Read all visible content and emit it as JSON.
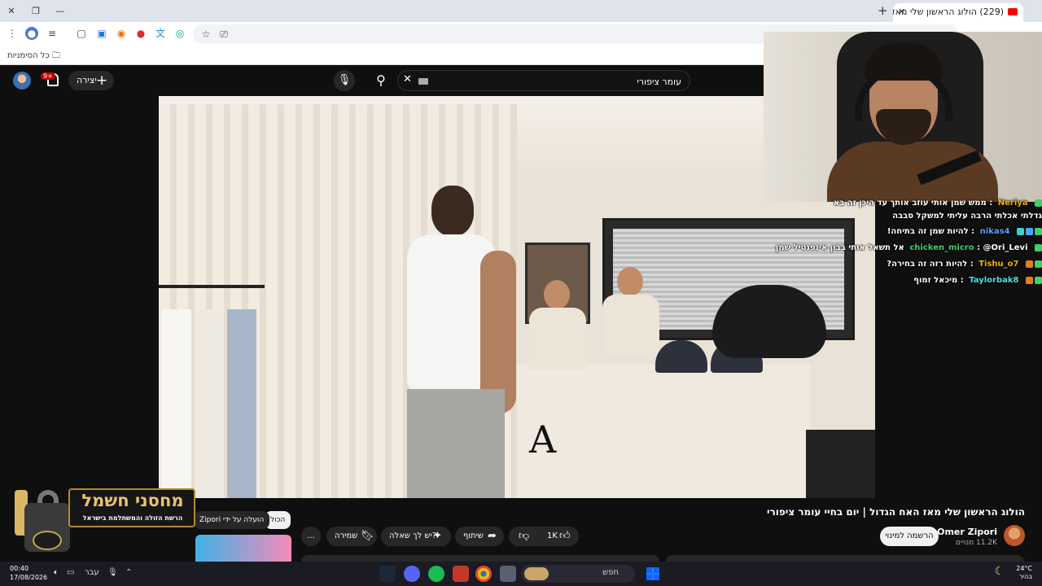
{
  "browser": {
    "tab_title": "(229) הולוג הראשון שלי מאז האח",
    "bookmarks_folder": "כל הסימניות"
  },
  "youtube": {
    "search_query": "עומר ציפורי",
    "create_label": "יצירה",
    "notification_count": "9+"
  },
  "video": {
    "title": "הולוג הראשון שלי מאז האח הגדול | יום בחיי עומר ציפורי",
    "channel_name": "Omer Zipori",
    "subscribers": "11.2K מנויים",
    "subscribe_label": "הרשמה למינוי",
    "likes": "1K",
    "share_label": "שיתוף",
    "ask_label": "יש לך שאלה?",
    "save_label": "שמירה",
    "more_label": "...",
    "scene_letter": "A"
  },
  "chips": {
    "all": "הכול",
    "uploaded_by": "הועלה על ידי Zipori"
  },
  "chat": [
    {
      "user": "Neriya",
      "user_color": "#f0b400",
      "message": "ממש שמן אותי עוזב אותך עד היכן זה בא"
    },
    {
      "user": "",
      "user_color": "#ffffff",
      "message": "גדלתי אכלתי הרבה עליתי למשקל סבבה"
    },
    {
      "user": "nikas4",
      "user_color": "#4fa3ff",
      "message": "להיות שמן זה בתיחה!"
    },
    {
      "user": "chicken_micro",
      "user_color": "#3ad36b",
      "message": "@Ori_Levi אל תשאל אותי בבון אינפנטיל שמן"
    },
    {
      "user": "Tishu_o7",
      "user_color": "#f0b400",
      "message": "להיות רזה זה בחירה?"
    },
    {
      "user": "Taylorbak8",
      "user_color": "#4fe0e0",
      "message": "מיכאל זמוף"
    }
  ],
  "sponsor": {
    "title": "מחסני חשמל",
    "subtitle": "הרשת הזולה והמשתלמת בישראל"
  },
  "taskbar": {
    "time": "00:40",
    "date": "17/08/2026",
    "language": "עבר",
    "search_label": "חפש",
    "weather_temp": "24°C",
    "weather_desc": "בהיר"
  }
}
